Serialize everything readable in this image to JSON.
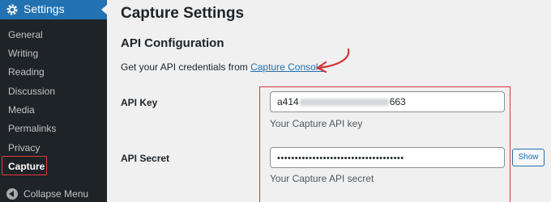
{
  "sidebar": {
    "header_title": "Settings",
    "items": [
      {
        "label": "General"
      },
      {
        "label": "Writing"
      },
      {
        "label": "Reading"
      },
      {
        "label": "Discussion"
      },
      {
        "label": "Media"
      },
      {
        "label": "Permalinks"
      },
      {
        "label": "Privacy"
      },
      {
        "label": "Capture"
      }
    ],
    "active_item": "Capture",
    "collapse_label": "Collapse Menu",
    "colors": {
      "background": "#1d2327",
      "header": "#2271b1",
      "highlight": "#e23c3c"
    }
  },
  "main": {
    "page_title": "Capture Settings",
    "section_title": "API Configuration",
    "description_prefix": "Get your API credentials from ",
    "description_link": "Capture Console",
    "fields": {
      "api_key": {
        "label": "API Key",
        "value_start": "a414",
        "value_end": "663",
        "hint": "Your Capture API key"
      },
      "api_secret": {
        "label": "API Secret",
        "value": "••••••••••••••••••••••••••••••••••••",
        "hint": "Your Capture API secret",
        "show_button": "Show"
      }
    },
    "colors": {
      "link": "#2271b1",
      "annotation": "#d63638"
    }
  }
}
